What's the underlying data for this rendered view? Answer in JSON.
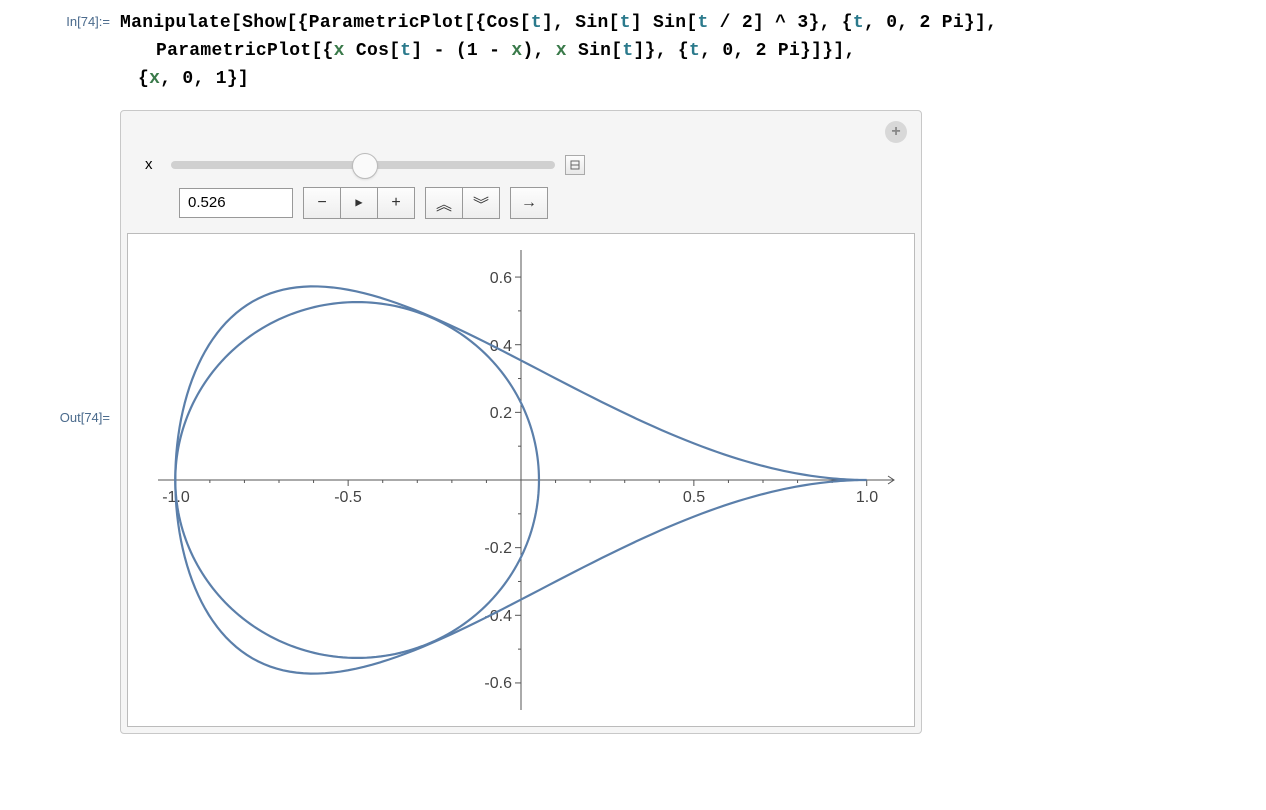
{
  "input_label": "In[74]:=",
  "output_label": "Out[74]=",
  "code": {
    "l1a": "Manipulate",
    "l1b": "[",
    "l1c": "Show",
    "l1d": "[{",
    "l1e": "ParametricPlot",
    "l1f": "[{",
    "l1g": "Cos",
    "l1h": "[",
    "l1t1": "t",
    "l1i": "], ",
    "l1j": "Sin",
    "l1k": "[",
    "l1t2": "t",
    "l1l": "] ",
    "l1m": "Sin",
    "l1n": "[",
    "l1t3": "t",
    "l1o": " / 2] ^ 3}, {",
    "l1t4": "t",
    "l1p": ", 0, 2 Pi}],",
    "l2a": "ParametricPlot",
    "l2b": "[{",
    "l2x1": "x",
    "l2c": " ",
    "l2d": "Cos",
    "l2e": "[",
    "l2t1": "t",
    "l2f": "] - (1 - ",
    "l2x2": "x",
    "l2g": "), ",
    "l2x3": "x",
    "l2h": " ",
    "l2i": "Sin",
    "l2j": "[",
    "l2t2": "t",
    "l2k": "]}, {",
    "l2t3": "t",
    "l2l": ", 0, 2 Pi}]}],",
    "l3a": "{",
    "l3x": "x",
    "l3b": ", 0, 1}]"
  },
  "slider": {
    "variable": "x",
    "value": "0.526",
    "collapse": "▤"
  },
  "buttons": {
    "minus": "−",
    "play": "▶",
    "plus": "+",
    "faster": "︽",
    "slower": "︾",
    "dir": "→",
    "add": "+"
  },
  "chart_data": {
    "type": "parametric",
    "x_range": [
      -1.05,
      1.05
    ],
    "y_range": [
      -0.68,
      0.68
    ],
    "x_ticks_labeled": [
      -1.0,
      -0.5,
      0.5,
      1.0
    ],
    "y_ticks_labeled": [
      -0.6,
      -0.4,
      -0.2,
      0.2,
      0.4,
      0.6
    ],
    "curves": [
      {
        "name": "teardrop",
        "formula_x": "cos(t)",
        "formula_y": "sin(t)*sin(t/2)^3",
        "t_range": [
          0,
          6.283185307
        ]
      },
      {
        "name": "circle",
        "formula_x": "0.526*cos(t) - 0.474",
        "formula_y": "0.526*sin(t)",
        "t_range": [
          0,
          6.283185307
        ],
        "center": [
          -0.474,
          0
        ],
        "radius": 0.526
      }
    ],
    "line_color": "#5b7faa"
  },
  "axis_labels": {
    "xn10": "-1.0",
    "xn05": "-0.5",
    "xp05": "0.5",
    "xp10": "1.0",
    "yn06": "-0.6",
    "yn04": "-0.4",
    "yn02": "-0.2",
    "yp02": "0.2",
    "yp04": "0.4",
    "yp06": "0.6"
  }
}
